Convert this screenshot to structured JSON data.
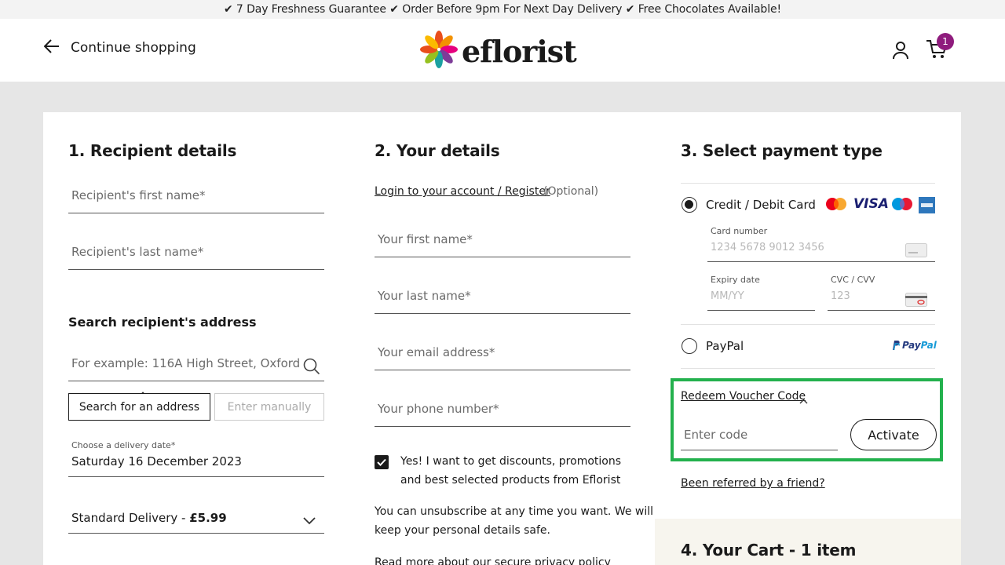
{
  "promo_bar": "✔ 7 Day Freshness Guarantee ✔ Order Before 9pm For Next Day Delivery ✔ Free Chocolates Available!",
  "header": {
    "back_label": "Continue shopping",
    "logo_text": "eflorist",
    "cart_count": "1"
  },
  "recipient": {
    "title": "1. Recipient details",
    "first_name_placeholder": "Recipient's first name*",
    "last_name_placeholder": "Recipient's last name*",
    "search_heading": "Search recipient's address",
    "search_placeholder": "For example: 116A High Street, Oxford",
    "tab_search": "Search for an address",
    "tab_manual": "Enter manually",
    "delivery_date_label": "Choose a delivery date*",
    "delivery_date_value": "Saturday 16 December 2023",
    "delivery_option_name": "Standard Delivery - ",
    "delivery_option_price": "£5.99"
  },
  "your_details": {
    "title": "2. Your details",
    "login_link": "Login to your account / Register",
    "optional": "(Optional)",
    "first_name_placeholder": "Your first name*",
    "last_name_placeholder": "Your last name*",
    "email_placeholder": "Your email address*",
    "phone_placeholder": "Your phone number*",
    "marketing_line1": "Yes! I want to get discounts, promotions",
    "marketing_line2": "and best selected products from Eflorist",
    "unsubscribe_line1": "You can unsubscribe at any time you want. We will",
    "unsubscribe_line2": "keep your personal details safe.",
    "privacy_text": "Read more about our secure privacy policy"
  },
  "payment": {
    "title": "3. Select payment type",
    "card_option": "Credit / Debit Card",
    "card_brands": [
      "mastercard",
      "VISA",
      "maestro",
      "amex"
    ],
    "card_number_label": "Card number",
    "card_number_placeholder": "1234 5678 9012 3456",
    "expiry_label": "Expiry date",
    "expiry_placeholder": "MM/YY",
    "cvc_label": "CVC / CVV",
    "cvc_placeholder": "123",
    "paypal_option": "PayPal",
    "paypal_logo": "PayPal",
    "voucher_link": "Redeem Voucher Code",
    "voucher_placeholder": "Enter code",
    "activate_label": "Activate",
    "referral_link": "Been referred by a friend?"
  },
  "cart": {
    "title": "4. Your Cart - 1 item"
  },
  "colors": {
    "badge": "#8f1c7d",
    "highlight": "#23b14d",
    "paypal_blue": "#253b80",
    "paypal_light": "#179bd7"
  }
}
